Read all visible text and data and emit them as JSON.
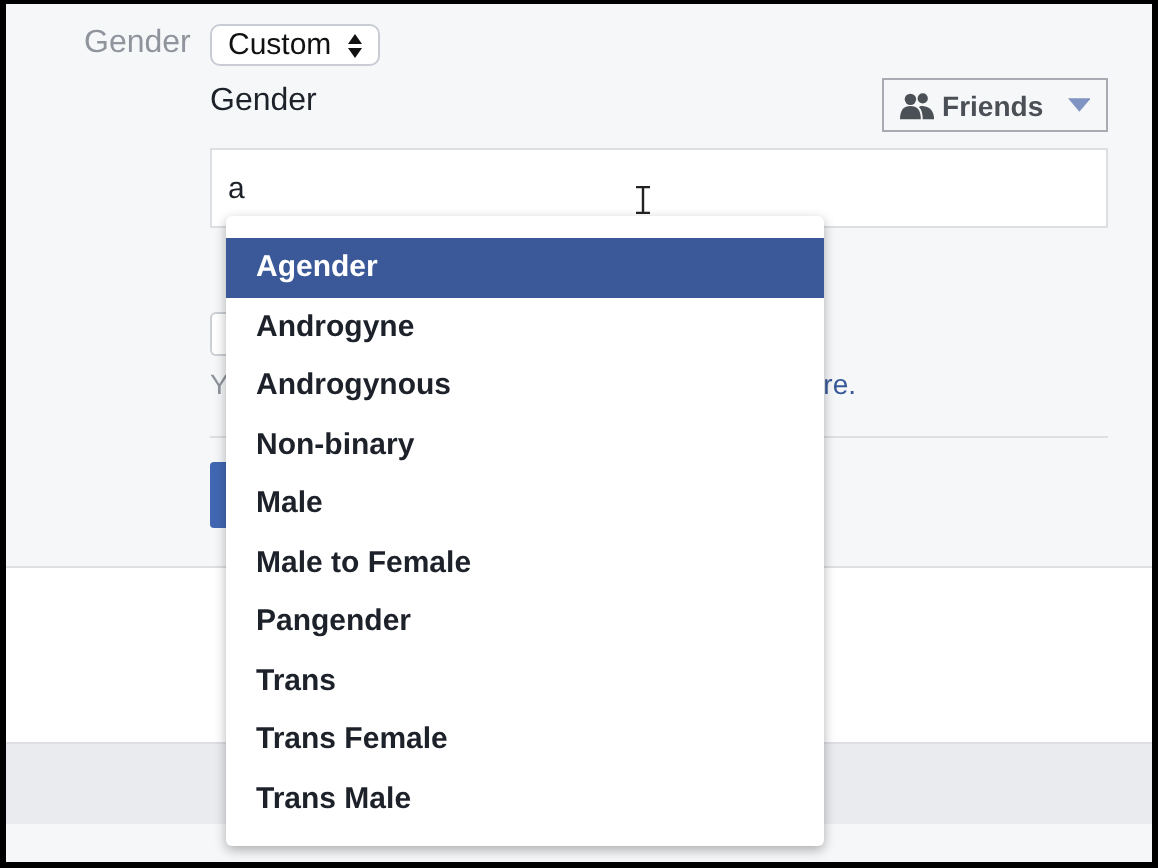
{
  "gender_row": {
    "label": "Gender",
    "select": "Custom"
  },
  "custom_gender": {
    "label": "Gender",
    "audience": "Friends",
    "value": "a"
  },
  "behind_dropdown": {
    "note_fragment": "Y",
    "link_fragment": "re."
  },
  "suggestions": [
    {
      "label": "Agender",
      "selected": true
    },
    {
      "label": "Androgyne",
      "selected": false
    },
    {
      "label": "Androgynous",
      "selected": false
    },
    {
      "label": "Non-binary",
      "selected": false
    },
    {
      "label": "Male",
      "selected": false
    },
    {
      "label": "Male to Female",
      "selected": false
    },
    {
      "label": "Pangender",
      "selected": false
    },
    {
      "label": "Trans",
      "selected": false
    },
    {
      "label": "Trans Female",
      "selected": false
    },
    {
      "label": "Trans Male",
      "selected": false
    }
  ]
}
